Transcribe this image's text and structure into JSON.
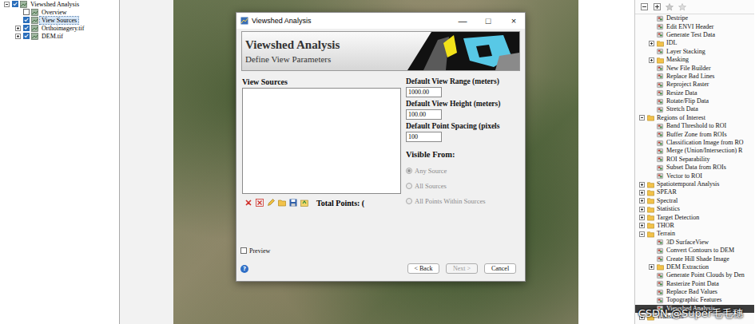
{
  "project_tree": {
    "items": [
      {
        "label": "Viewshed Analysis",
        "level": 0,
        "expandable": true,
        "expanded": true,
        "checked": true,
        "selected": false
      },
      {
        "label": "Overview",
        "level": 1,
        "expandable": false,
        "expanded": false,
        "checked": false,
        "selected": false
      },
      {
        "label": "View Sources",
        "level": 1,
        "expandable": false,
        "expanded": false,
        "checked": true,
        "selected": true
      },
      {
        "label": "Orthoimagery.tif",
        "level": 1,
        "expandable": true,
        "expanded": false,
        "checked": true,
        "selected": false
      },
      {
        "label": "DEM.tif",
        "level": 1,
        "expandable": true,
        "expanded": false,
        "checked": true,
        "selected": false
      }
    ]
  },
  "dialog": {
    "title": "Viewshed Analysis",
    "controls": [
      "—",
      "□",
      "×"
    ],
    "header": {
      "title": "Viewshed Analysis",
      "subtitle": "Define View Parameters"
    },
    "sources_label": "View Sources",
    "sources": [],
    "fields": [
      {
        "label": "Default View Range (meters)",
        "value": "1000.00"
      },
      {
        "label": "Default View Height (meters)",
        "value": "100.00"
      },
      {
        "label": "Default Point Spacing (pixels",
        "value": "100"
      }
    ],
    "visible_from": {
      "label": "Visible From:",
      "options": [
        {
          "label": "Any Source",
          "selected": true,
          "disabled": true
        },
        {
          "label": "All Sources",
          "selected": false,
          "disabled": true
        },
        {
          "label": "All Points Within Sources",
          "selected": false,
          "disabled": true
        }
      ]
    },
    "total_points": "Total Points: (",
    "preview": {
      "label": "Preview",
      "checked": false
    },
    "help": "?",
    "buttons": [
      {
        "label": "< Back",
        "disabled": false
      },
      {
        "label": "Next >",
        "disabled": true
      },
      {
        "label": "Cancel",
        "disabled": false
      }
    ]
  },
  "toolbox": {
    "items": [
      {
        "label": "Destripe",
        "level": 1,
        "kind": "tool",
        "expanded": false,
        "selected": false
      },
      {
        "label": "Edit ENVI Header",
        "level": 1,
        "kind": "tool",
        "expanded": false,
        "selected": false
      },
      {
        "label": "Generate Test Data",
        "level": 1,
        "kind": "tool",
        "expanded": false,
        "selected": false
      },
      {
        "label": "IDL",
        "level": 1,
        "kind": "folder",
        "expanded": false,
        "selected": false
      },
      {
        "label": "Layer Stacking",
        "level": 1,
        "kind": "tool",
        "expanded": false,
        "selected": false
      },
      {
        "label": "Masking",
        "level": 1,
        "kind": "folder",
        "expanded": false,
        "selected": false
      },
      {
        "label": "New File Builder",
        "level": 1,
        "kind": "tool",
        "expanded": false,
        "selected": false
      },
      {
        "label": "Replace Bad Lines",
        "level": 1,
        "kind": "tool",
        "expanded": false,
        "selected": false
      },
      {
        "label": "Reproject Raster",
        "level": 1,
        "kind": "tool",
        "expanded": false,
        "selected": false
      },
      {
        "label": "Resize Data",
        "level": 1,
        "kind": "tool",
        "expanded": false,
        "selected": false
      },
      {
        "label": "Rotate/Flip Data",
        "level": 1,
        "kind": "tool",
        "expanded": false,
        "selected": false
      },
      {
        "label": "Stretch Data",
        "level": 1,
        "kind": "tool",
        "expanded": false,
        "selected": false
      },
      {
        "label": "Regions of Interest",
        "level": 0,
        "kind": "folder",
        "expanded": true,
        "selected": false
      },
      {
        "label": "Band Threshold to ROI",
        "level": 1,
        "kind": "tool",
        "expanded": false,
        "selected": false
      },
      {
        "label": "Buffer Zone from ROIs",
        "level": 1,
        "kind": "tool",
        "expanded": false,
        "selected": false
      },
      {
        "label": "Classification Image from RO",
        "level": 1,
        "kind": "tool",
        "expanded": false,
        "selected": false
      },
      {
        "label": "Merge (Union/Intersection) R",
        "level": 1,
        "kind": "tool",
        "expanded": false,
        "selected": false
      },
      {
        "label": "ROI Separability",
        "level": 1,
        "kind": "tool",
        "expanded": false,
        "selected": false
      },
      {
        "label": "Subset Data from ROIs",
        "level": 1,
        "kind": "tool",
        "expanded": false,
        "selected": false
      },
      {
        "label": "Vector to ROI",
        "level": 1,
        "kind": "tool",
        "expanded": false,
        "selected": false
      },
      {
        "label": "Spatiotemporal Analysis",
        "level": 0,
        "kind": "folder",
        "expanded": false,
        "selected": false
      },
      {
        "label": "SPEAR",
        "level": 0,
        "kind": "folder",
        "expanded": false,
        "selected": false
      },
      {
        "label": "Spectral",
        "level": 0,
        "kind": "folder",
        "expanded": false,
        "selected": false
      },
      {
        "label": "Statistics",
        "level": 0,
        "kind": "folder",
        "expanded": false,
        "selected": false
      },
      {
        "label": "Target Detection",
        "level": 0,
        "kind": "folder",
        "expanded": false,
        "selected": false
      },
      {
        "label": "THOR",
        "level": 0,
        "kind": "folder",
        "expanded": false,
        "selected": false
      },
      {
        "label": "Terrain",
        "level": 0,
        "kind": "folder",
        "expanded": true,
        "selected": false
      },
      {
        "label": "3D SurfaceView",
        "level": 1,
        "kind": "tool",
        "expanded": false,
        "selected": false
      },
      {
        "label": "Convert Contours to DEM",
        "level": 1,
        "kind": "tool",
        "expanded": false,
        "selected": false
      },
      {
        "label": "Create Hill Shade Image",
        "level": 1,
        "kind": "tool",
        "expanded": false,
        "selected": false
      },
      {
        "label": "DEM Extraction",
        "level": 1,
        "kind": "folder",
        "expanded": false,
        "selected": false
      },
      {
        "label": "Generate Point Clouds by Den",
        "level": 1,
        "kind": "tool",
        "expanded": false,
        "selected": false
      },
      {
        "label": "Rasterize Point Data",
        "level": 1,
        "kind": "tool",
        "expanded": false,
        "selected": false
      },
      {
        "label": "Replace Bad Values",
        "level": 1,
        "kind": "tool",
        "expanded": false,
        "selected": false
      },
      {
        "label": "Topographic Features",
        "level": 1,
        "kind": "tool",
        "expanded": false,
        "selected": false
      },
      {
        "label": "Viewshed Analysis",
        "level": 1,
        "kind": "tool",
        "expanded": false,
        "selected": true
      },
      {
        "label": "Transform",
        "level": 0,
        "kind": "folder",
        "expanded": false,
        "selected": false
      }
    ]
  },
  "watermark": "CSDN @Super毛毛穗"
}
